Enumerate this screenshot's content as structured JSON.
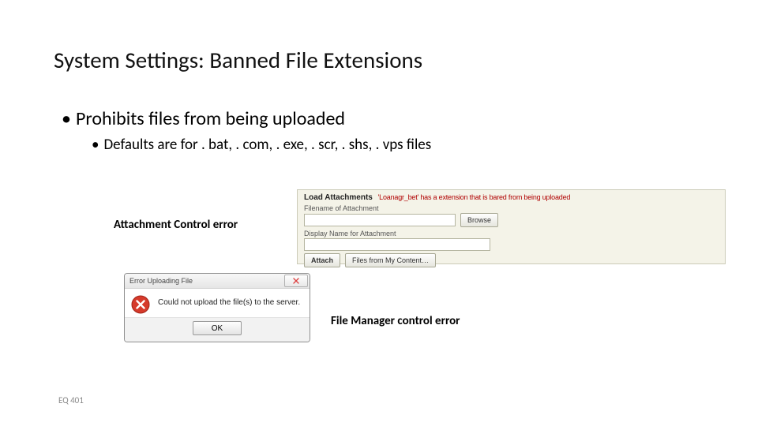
{
  "title": "System Settings: Banned File Extensions",
  "bullets": {
    "level1": "Prohibits files from being uploaded",
    "level2": "Defaults are for . bat, . com, . exe, . scr, . shs, . vps files"
  },
  "labels": {
    "attachment_control_error": "Attachment Control error",
    "file_manager_control_error": "File Manager control error"
  },
  "attach_panel": {
    "header_strong": "Load Attachments",
    "header_error": "'Loanagr_bet' has a extension that is bared from being uploaded",
    "filename_label": "Filename of Attachment",
    "browse_btn": "Browse",
    "displayname_label": "Display Name for Attachment",
    "attach_btn": "Attach",
    "files_btn": "Files from My Content…",
    "input1_value": "",
    "input2_value": ""
  },
  "dialog": {
    "title": "Error Uploading File",
    "message": "Could not upload the file(s) to the server.",
    "ok": "OK"
  },
  "footer": "EQ 401"
}
